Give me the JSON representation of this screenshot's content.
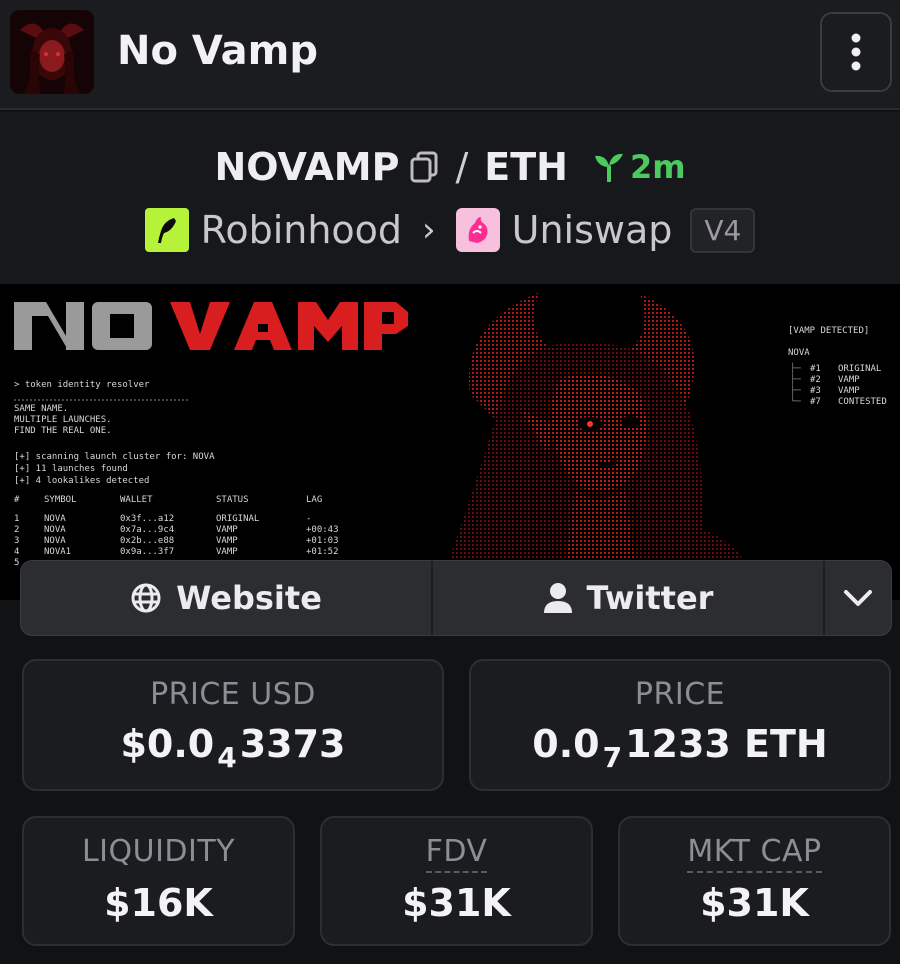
{
  "header": {
    "token_name": "No Vamp",
    "menu_icon": "more-vertical-icon"
  },
  "pair": {
    "base": "NOVAMP",
    "separator": "/",
    "quote": "ETH",
    "age": "2m",
    "age_color": "#4cc95f"
  },
  "dex": {
    "chain": "Robinhood",
    "dex_name": "Uniswap",
    "version": "V4"
  },
  "banner": {
    "title_word1": "NO",
    "title_word2": "VAMP",
    "subtitle": "> token identity resolver",
    "lines": [
      "SAME NAME.",
      "MULTIPLE LAUNCHES."
    ],
    "highlight_line": "FIND THE REAL ONE.",
    "scan_lines": [
      "[+] scanning launch cluster for: NOVA",
      "[+] 11 launches found",
      "[+] 4 lookalikes detected"
    ],
    "table_headers": [
      "#",
      "SYMBOL",
      "WALLET",
      "STATUS",
      "LAG"
    ],
    "table_rows": [
      [
        "1",
        "NOVA",
        "0x3f...a12",
        "ORIGINAL",
        "-"
      ],
      [
        "2",
        "NOVA",
        "0x7a...9c4",
        "VAMP",
        "+00:43"
      ],
      [
        "3",
        "NOVA",
        "0x2b...e88",
        "VAMP",
        "+01:03"
      ],
      [
        "4",
        "NOVA1",
        "0x9a...3f7",
        "VAMP",
        "+01:52"
      ],
      [
        "5",
        "",
        "",
        "",
        ""
      ]
    ],
    "detected_title": "[VAMP DETECTED]",
    "detected_root": "NOVA",
    "detected_items": [
      {
        "rank": "#1",
        "status": "ORIGINAL"
      },
      {
        "rank": "#2",
        "status": "VAMP"
      },
      {
        "rank": "#3",
        "status": "VAMP"
      },
      {
        "rank": "#7",
        "status": "CONTESTED"
      }
    ],
    "accent": "#e02020"
  },
  "links": {
    "website": "Website",
    "twitter": "Twitter",
    "website_icon": "globe-icon",
    "twitter_icon": "user-icon",
    "more_icon": "chevron-down-icon"
  },
  "stats": {
    "price_usd_label": "PRICE USD",
    "price_usd_prefix": "$0.0",
    "price_usd_zeros": "4",
    "price_usd_digits": "3373",
    "price_label": "PRICE",
    "price_prefix": "0.0",
    "price_zeros": "7",
    "price_digits": "1233 ETH",
    "liquidity_label": "LIQUIDITY",
    "liquidity_value": "$16K",
    "fdv_label": "FDV",
    "fdv_value": "$31K",
    "mktcap_label": "MKT CAP",
    "mktcap_value": "$31K"
  }
}
